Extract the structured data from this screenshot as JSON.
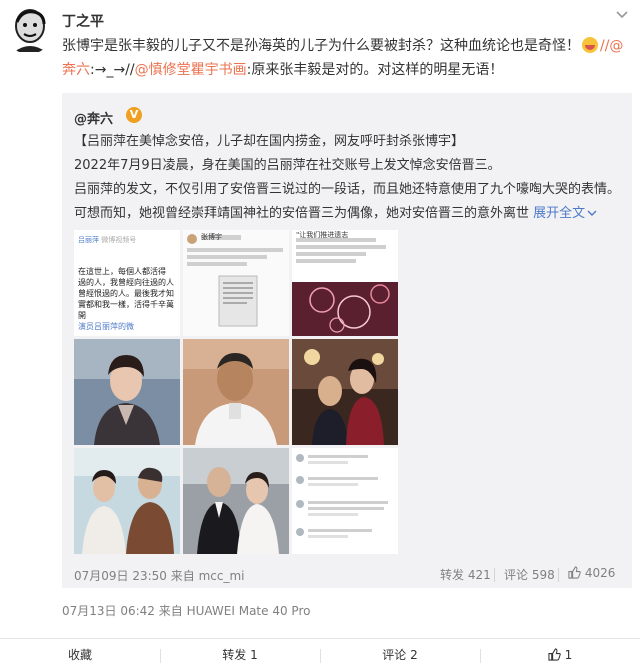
{
  "post": {
    "author": "丁之平",
    "text_main": "张博宇是张丰毅的儿子又不是孙海英的儿子为什么要被封杀？这种血统论也是奇怪！",
    "text_link1": "//@奔六",
    "text_mid": ":→_→//",
    "text_link2": "@慎修堂瞿宇书画",
    "text_tail": ":原来张丰毅是对的。对这样的明星无语！",
    "timestamp_device": "07月13日 06:42 来自 HUAWEI Mate 40 Pro"
  },
  "repost": {
    "author": "@奔六",
    "badge": "V",
    "headline": "【吕丽萍在美悼念安倍，儿子却在国内捞金，网友呼吁封杀张博宇】",
    "para1": "2022年7月9日凌晨，身在美国的吕丽萍在社交账号上发文悼念安倍晋三。",
    "para2": "吕丽萍的发文，不仅引用了安倍晋三说过的一段话，而且她还特意使用了九个嚎啕大哭的表情。可想而知，她视曾经崇拜靖国神社的安倍晋三为偶像，她对安倍晋三的意外离世",
    "expand": "展开全文",
    "meta": "07月09日 23:50 来自 mcc_mi",
    "forward": "转发 421",
    "comment": "评论 598",
    "likes": "4026",
    "img1_lines": [
      "吕丽萍",
      "微博视频号",
      "在這世上，每個人都活得",
      "過的人，我曾經向往過的人",
      "曾經恨過的人。最後我才知",
      "實都和我一樣，活得千辛萬",
      "開",
      "演员吕丽萍的微"
    ],
    "img2_lines": [
      "张博宇"
    ],
    "img3_lines": [
      "\"让我们推进遗志"
    ]
  },
  "footer": {
    "collect": "收藏",
    "forward": "转发 1",
    "comment": "评论 2",
    "like": "1"
  },
  "colors": {
    "accent_orange": "#eb7350",
    "link_blue": "#4d7ac9",
    "repost_bg": "#f2f2f5",
    "meta_gray": "#808080"
  }
}
